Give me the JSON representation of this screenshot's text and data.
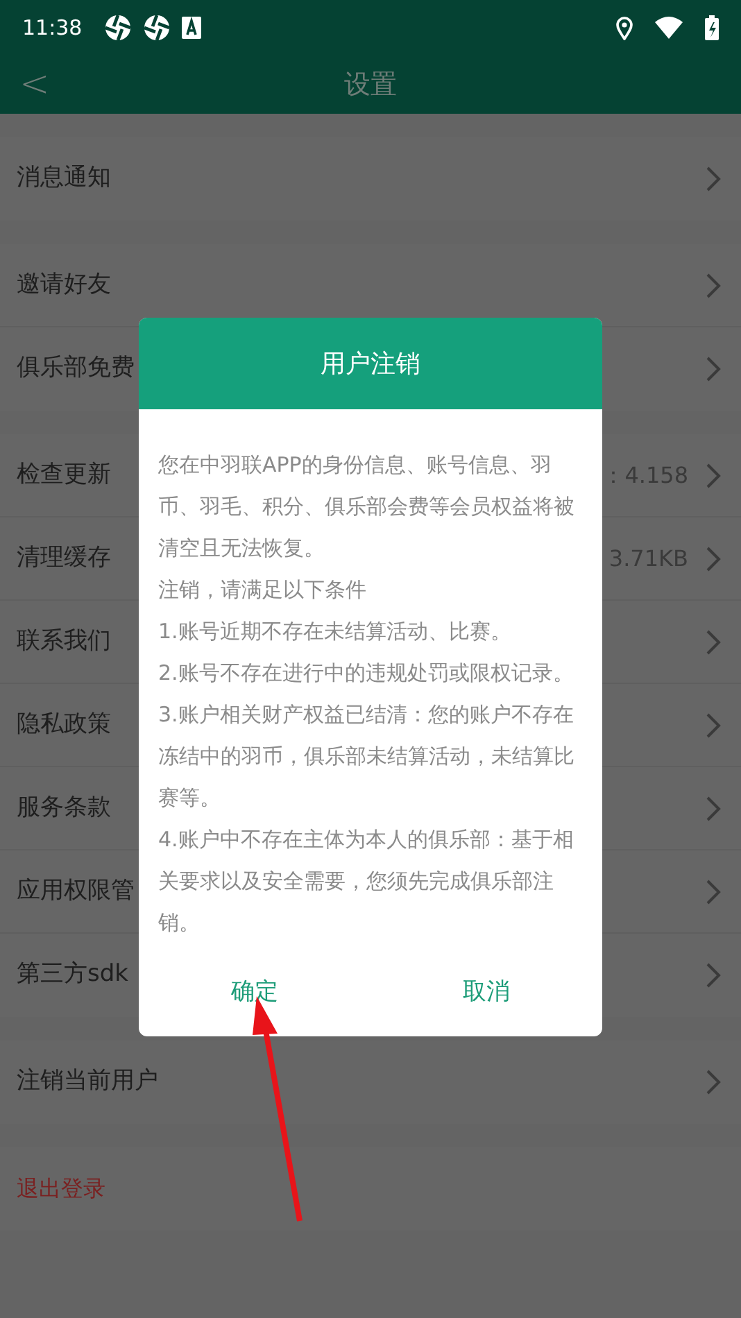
{
  "status_bar": {
    "time": "11:38"
  },
  "header": {
    "back": "<",
    "title": "设置"
  },
  "groups": [
    {
      "rows": [
        {
          "label": "消息通知"
        }
      ]
    },
    {
      "rows": [
        {
          "label": "邀请好友"
        },
        {
          "label": "俱乐部免费"
        }
      ]
    },
    {
      "rows": [
        {
          "label": "检查更新",
          "value": "：4.158"
        },
        {
          "label": "清理缓存",
          "value": "3.71KB"
        },
        {
          "label": "联系我们"
        },
        {
          "label": "隐私政策"
        },
        {
          "label": "服务条款"
        },
        {
          "label": "应用权限管"
        },
        {
          "label": "第三方sdk"
        }
      ]
    },
    {
      "rows": [
        {
          "label": "注销当前用户"
        }
      ]
    },
    {
      "rows": [
        {
          "label": "退出登录",
          "kind": "danger"
        }
      ]
    }
  ],
  "dialog": {
    "title": "用户注销",
    "paragraphs": [
      "您在中羽联APP的身份信息、账号信息、羽币、羽毛、积分、俱乐部会费等会员权益将被清空且无法恢复。",
      "注销，请满足以下条件",
      "1.账号近期不存在未结算活动、比赛。",
      "2.账号不存在进行中的违规处罚或限权记录。",
      "3.账户相关财产权益已结清：您的账户不存在冻结中的羽币，俱乐部未结算活动，未结算比赛等。",
      "4.账户中不存在主体为本人的俱乐部：基于相关要求以及安全需要，您须先完成俱乐部注销。"
    ],
    "buttons": [
      "确定",
      "取消"
    ]
  }
}
